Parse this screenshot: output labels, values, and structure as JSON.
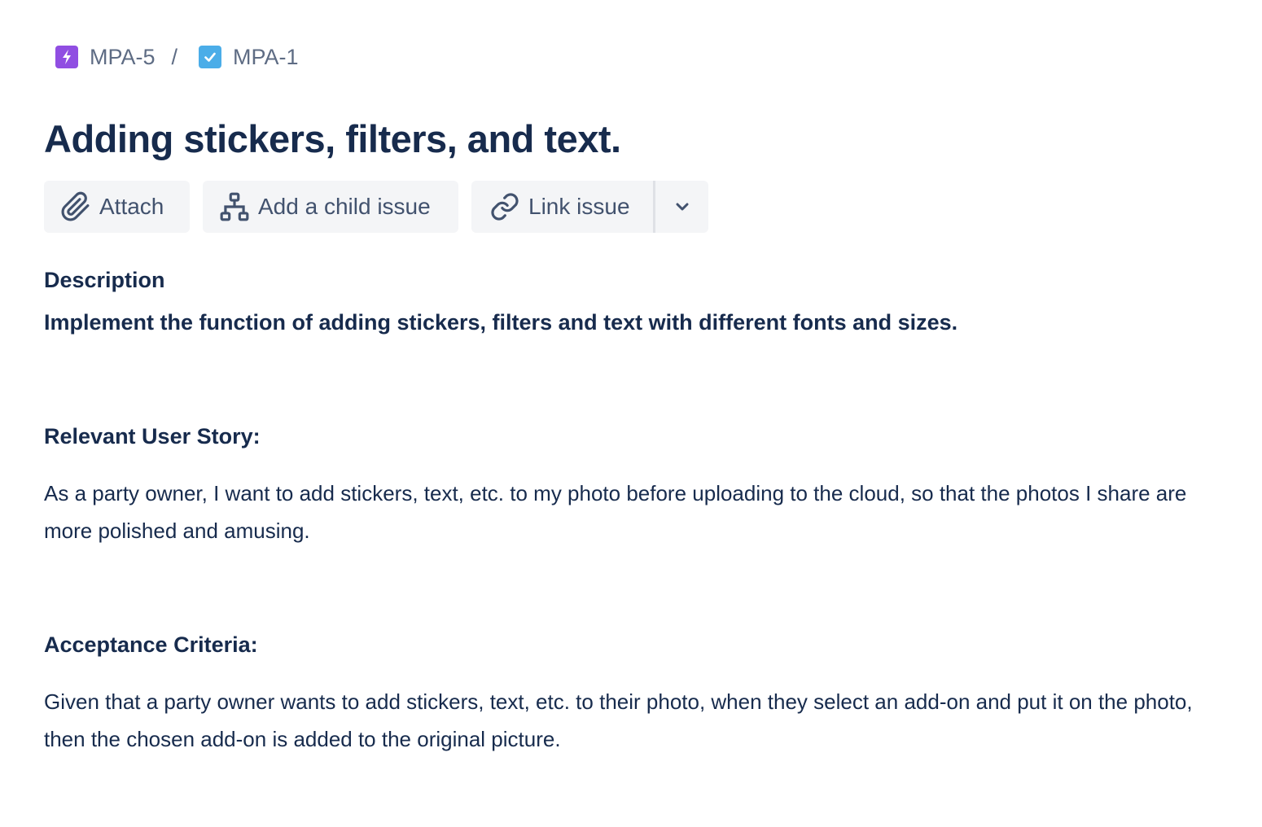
{
  "breadcrumb": {
    "parent": {
      "key": "MPA-5",
      "icon": "epic-lightning-icon",
      "color": "#904ee2"
    },
    "separator": "/",
    "current": {
      "key": "MPA-1",
      "icon": "task-checkbox-icon",
      "color": "#4bade8"
    }
  },
  "issue": {
    "title": "Adding stickers, filters, and text."
  },
  "toolbar": {
    "attach_label": "Attach",
    "attach_icon": "paperclip-icon",
    "child_label": "Add a child issue",
    "child_icon": "hierarchy-icon",
    "link_label": "Link issue",
    "link_icon": "link-icon",
    "more_icon": "chevron-down-icon"
  },
  "description": {
    "label": "Description",
    "summary": "Implement the function of adding stickers, filters and text with different fonts and sizes.",
    "story_heading": "Relevant User Story:",
    "story_text": "As a party owner, I want to add stickers, text, etc. to my photo before uploading to the cloud, so that the photos I share are more polished and amusing.",
    "criteria_heading": "Acceptance Criteria:",
    "criteria_text": "Given that a party owner wants to add stickers, text, etc. to their photo, when they select an add-on and put it on the photo, then the chosen add-on is added to the original picture."
  }
}
